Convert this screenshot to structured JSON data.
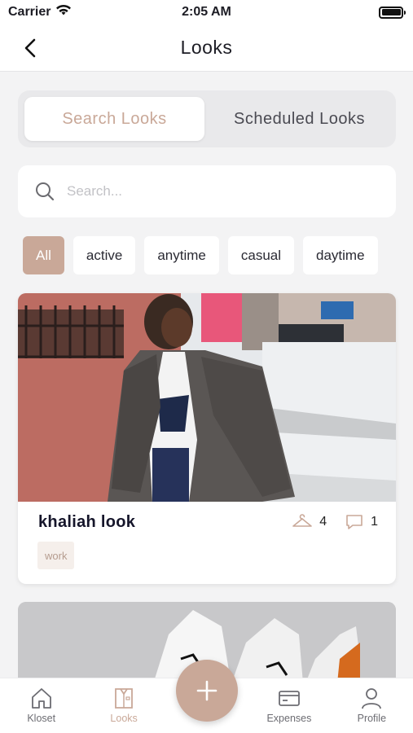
{
  "status_bar": {
    "carrier": "Carrier",
    "time": "2:05 AM"
  },
  "nav": {
    "title": "Looks"
  },
  "segment": {
    "options": [
      "Search Looks",
      "Scheduled Looks"
    ],
    "selected": "Search Looks"
  },
  "search": {
    "placeholder": "Search..."
  },
  "filters": {
    "chips": [
      "All",
      "active",
      "anytime",
      "casual",
      "daytime"
    ],
    "selected": "All"
  },
  "looks": [
    {
      "name": "khaliah look",
      "items_count": "4",
      "comments_count": "1",
      "tags": [
        "work"
      ]
    }
  ],
  "tabbar": {
    "tabs": [
      {
        "label": "Kloset",
        "icon": "home-icon"
      },
      {
        "label": "Looks",
        "icon": "shirt-icon"
      },
      {
        "label": "Expenses",
        "icon": "card-icon"
      },
      {
        "label": "Profile",
        "icon": "person-icon"
      }
    ],
    "active": "Looks"
  },
  "colors": {
    "accent": "#c9a898",
    "background": "#f3f3f4",
    "text": "#1c1c24"
  }
}
